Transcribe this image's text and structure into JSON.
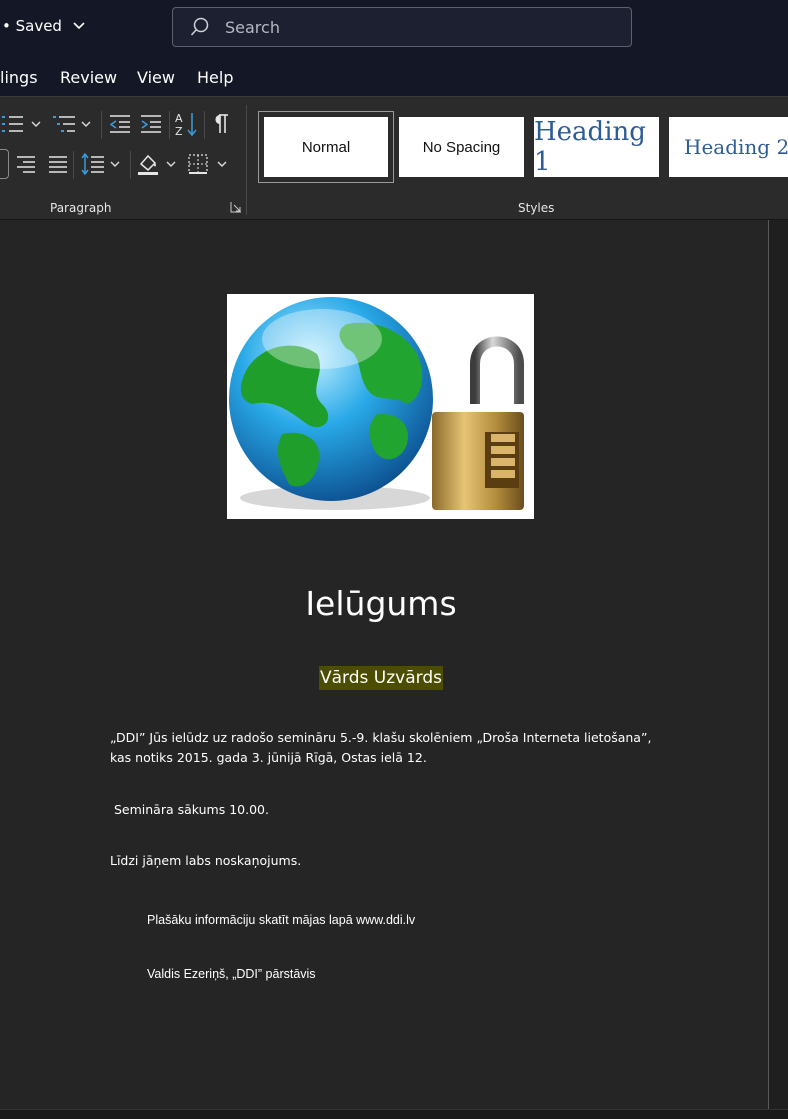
{
  "titlebar": {
    "saved_label": "• Saved",
    "search_placeholder": "Search"
  },
  "menu": {
    "items": [
      "lings",
      "Review",
      "View",
      "Help"
    ]
  },
  "ribbon": {
    "paragraph_group_label": "Paragraph",
    "styles_group_label": "Styles",
    "styles": {
      "normal": "Normal",
      "no_spacing": "No Spacing",
      "heading1": "Heading 1",
      "heading2": "Heading 2"
    },
    "heading_color": "#2e5c95"
  },
  "document": {
    "title": "Ielūgums",
    "name": "Vārds Uzvārds",
    "name_highlight": "#4d4d00",
    "paragraph1": "„DDI” Jūs ielūdz uz radošo semināru 5.-9. klašu skolēniem „Droša Interneta lietošana”, kas notiks 2015. gada 3. jūnijā Rīgā, Ostas ielā 12.",
    "paragraph2": " Semināra sākums 10.00.",
    "paragraph3": "Līdzi jāņem labs noskaņojums.",
    "info_line": "Plašāku informāciju skatīt mājas lapā www.ddi.lv",
    "signature": "Valdis Ezeriņš, „DDI” pārstāvis"
  }
}
